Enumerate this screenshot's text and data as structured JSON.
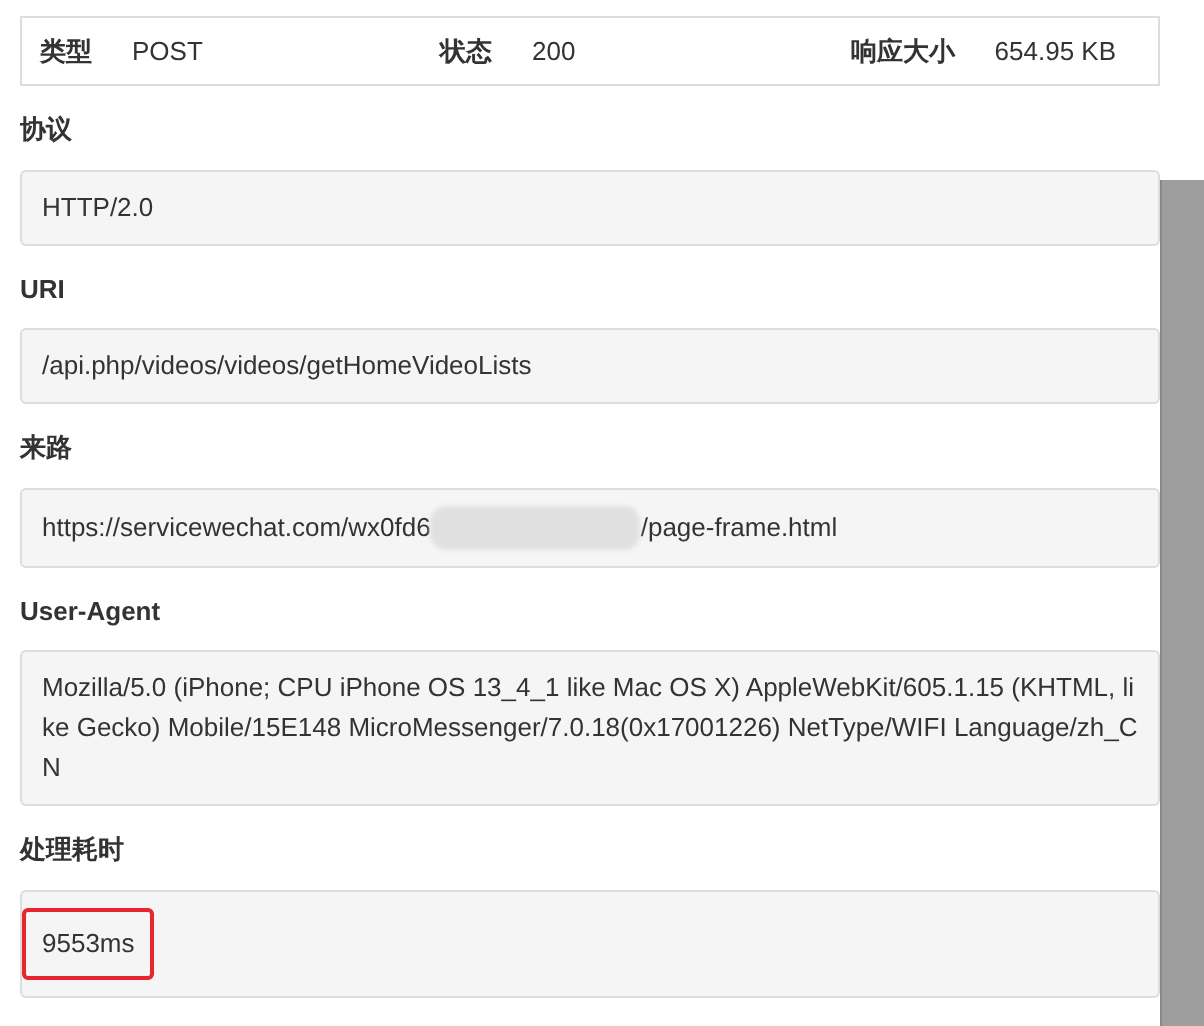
{
  "summary": [
    {
      "label": "类型",
      "value": "POST"
    },
    {
      "label": "状态",
      "value": "200"
    },
    {
      "label": "响应大小",
      "value": "654.95 KB"
    }
  ],
  "fields": [
    {
      "label": "协议",
      "value": "HTTP/2.0",
      "highlighted": false
    },
    {
      "label": "URI",
      "value": "/api.php/videos/videos/getHomeVideoLists",
      "highlighted": false
    },
    {
      "label": "来路",
      "value": "https://servicewechat.com/wx0fd6",
      "value_after": "/page-frame.html",
      "redacted": true,
      "highlighted": false
    },
    {
      "label": "User-Agent",
      "value": "Mozilla/5.0 (iPhone; CPU iPhone OS 13_4_1 like Mac OS X) AppleWebKit/605.1.15 (KHTML, like Gecko) Mobile/15E148 MicroMessenger/7.0.18(0x17001226) NetType/WIFI Language/zh_CN",
      "highlighted": false
    },
    {
      "label": "处理耗时",
      "value": "9553ms",
      "highlighted": true
    }
  ]
}
